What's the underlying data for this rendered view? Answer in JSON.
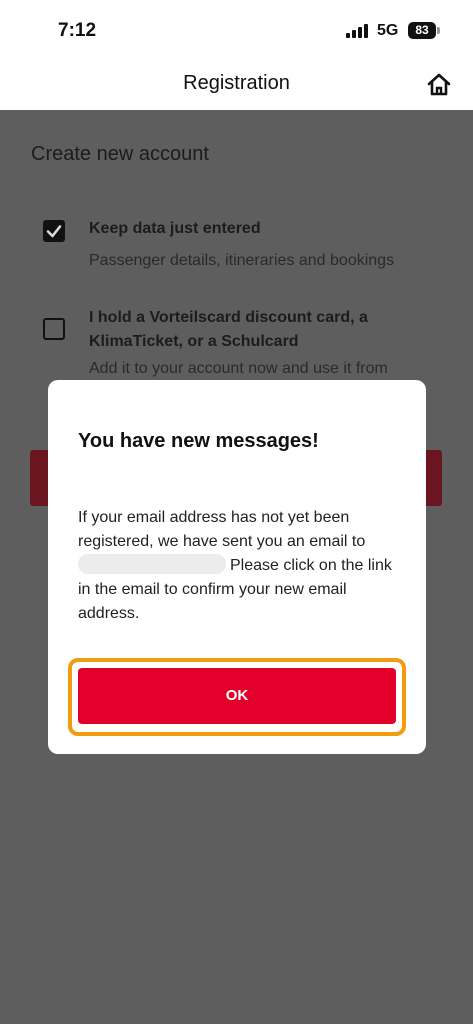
{
  "status_bar": {
    "time": "7:12",
    "network": "5G",
    "battery": "83"
  },
  "nav": {
    "title": "Registration",
    "home_icon": "home-icon"
  },
  "background": {
    "heading": "Create new account",
    "options": [
      {
        "title": "Keep data just entered",
        "subtitle": "Passenger details, itineraries and bookings",
        "checked": true
      },
      {
        "title": "I hold a Vorteilscard discount card, a KlimaTicket, or a Schulcard",
        "subtitle": "Add it to your account now and use it from",
        "checked": false
      }
    ]
  },
  "dialog": {
    "title": "You have new messages!",
    "message_part1": "If your email address has not yet been registered, we have sent you an email to",
    "message_part2": "Please click on the link in the email to confirm your new email address.",
    "ok_label": "OK"
  },
  "colors": {
    "accent": "#e2002a",
    "highlight": "#f29b10",
    "overlay": "#5e5e5e"
  }
}
